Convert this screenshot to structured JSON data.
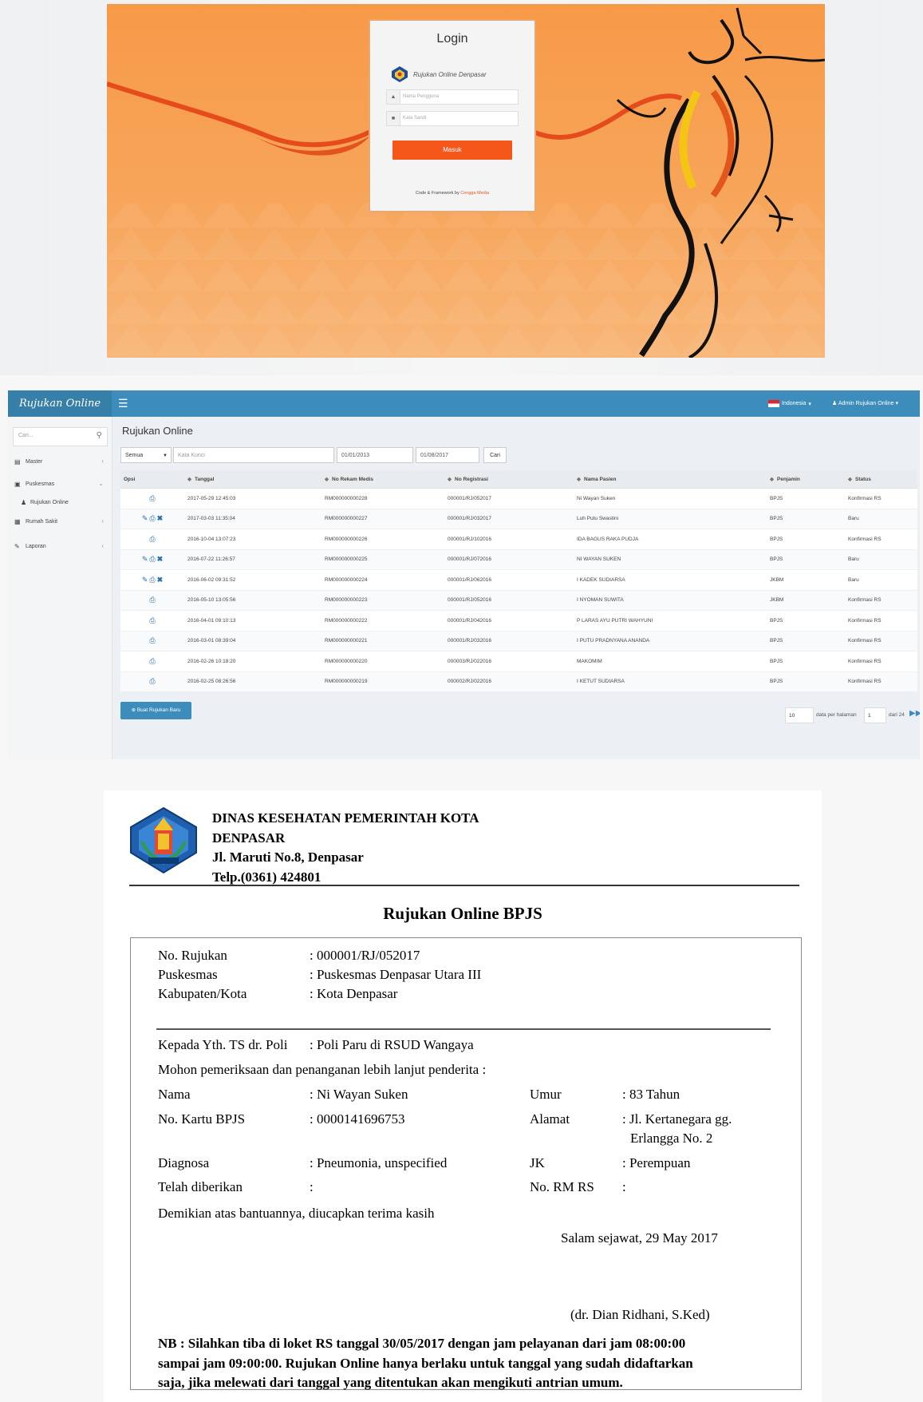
{
  "login": {
    "title": "Login",
    "app_name": "Rujukan Online Denpasar",
    "username_placeholder": "Nama Pengguna",
    "password_placeholder": "Kata Sandi",
    "submit_label": "Masuk",
    "footer_prefix": "Code & Framework by",
    "footer_link": "Cengga Media",
    "accent_color": "#f5561a"
  },
  "admin": {
    "brand": "Rujukan Online",
    "language": "Indonesia",
    "user": "Admin Rujukan Online",
    "search_placeholder": "Cari...",
    "menu": [
      {
        "label": "Master",
        "icon": "database-icon"
      },
      {
        "label": "Puskesmas",
        "icon": "plus-square-icon"
      },
      {
        "label": "Rujukan Online",
        "icon": "user-icon"
      },
      {
        "label": "Rumah Sakit",
        "icon": "hospital-icon"
      },
      {
        "label": "Laporan",
        "icon": "report-icon"
      }
    ],
    "page_title": "Rujukan Online",
    "filter": {
      "select_value": "Semua",
      "keyword_placeholder": "Kata Kunci",
      "date_from": "01/01/2013",
      "date_to": "01/08/2017",
      "search_button": "Cari"
    },
    "columns": [
      "Opsi",
      "Tanggal",
      "No Rekam Medis",
      "No Registrasi",
      "Nama Pasien",
      "Penjamin",
      "Status"
    ],
    "rows": [
      {
        "actions": "print",
        "tanggal": "2017-05-29 12:45:03",
        "rm": "RM000000000228",
        "reg": "000001/RJ/052017",
        "nama": "Ni Wayan Suken",
        "penjamin": "BPJS",
        "status": "Konfirmasi RS"
      },
      {
        "actions": "edit-print-delete",
        "tanggal": "2017-03-03 11:35:04",
        "rm": "RM000000000227",
        "reg": "000001/RJ/032017",
        "nama": "Luh Putu Swastini",
        "penjamin": "BPJS",
        "status": "Baru"
      },
      {
        "actions": "print",
        "tanggal": "2016-10-04 13:07:23",
        "rm": "RM000000000226",
        "reg": "000001/RJ/102016",
        "nama": "IDA BAGUS RAKA PUDJA",
        "penjamin": "BPJS",
        "status": "Konfirmasi RS"
      },
      {
        "actions": "edit-print-delete",
        "tanggal": "2016-07-22 11:26:57",
        "rm": "RM000000000225",
        "reg": "000001/RJ/072016",
        "nama": "NI WAYAN SUKEN",
        "penjamin": "BPJS",
        "status": "Baru"
      },
      {
        "actions": "edit-print-delete",
        "tanggal": "2016-06-02 09:31:52",
        "rm": "RM000000000224",
        "reg": "000001/RJ/062016",
        "nama": "I KADEK SUDIARSA",
        "penjamin": "JKBM",
        "status": "Baru"
      },
      {
        "actions": "print",
        "tanggal": "2016-05-10 13:05:56",
        "rm": "RM000000000223",
        "reg": "000001/RJ/052016",
        "nama": "I NYOMAN SUWITA",
        "penjamin": "JKBM",
        "status": "Konfirmasi RS"
      },
      {
        "actions": "print",
        "tanggal": "2016-04-01 09:10:13",
        "rm": "RM000000000222",
        "reg": "000001/RJ/042016",
        "nama": "P LARAS AYU PUTRI WAHYUNI",
        "penjamin": "BPJS",
        "status": "Konfirmasi RS"
      },
      {
        "actions": "print",
        "tanggal": "2016-03-01 08:39:04",
        "rm": "RM000000000221",
        "reg": "000001/RJ/032016",
        "nama": "I PUTU PRADNYANA ANANDA",
        "penjamin": "BPJS",
        "status": "Konfirmasi RS"
      },
      {
        "actions": "print",
        "tanggal": "2016-02-26 10:18:20",
        "rm": "RM000000000220",
        "reg": "000003/RJ/022016",
        "nama": "MAKOMIM",
        "penjamin": "BPJS",
        "status": "Konfirmasi RS"
      },
      {
        "actions": "print",
        "tanggal": "2016-02-25 08:26:56",
        "rm": "RM000000000219",
        "reg": "000002/RJ/022016",
        "nama": "I KETUT SUDIARSA",
        "penjamin": "BPJS",
        "status": "Konfirmasi RS"
      }
    ],
    "new_button": "Buat Rujukan Baru",
    "pager": {
      "per_page": "10",
      "per_page_label": "data per halaman",
      "page": "1",
      "total_label": "dari 24"
    },
    "theme_color": "#3c8dbc"
  },
  "letter": {
    "header_lines": [
      "DINAS KESEHATAN PEMERINTAH KOTA",
      "DENPASAR",
      "Jl. Maruti No.8, Denpasar",
      "Telp.(0361) 424801"
    ],
    "title": "Rujukan Online BPJS",
    "fields_top": [
      {
        "label": "No. Rujukan",
        "value": ": 000001/RJ/052017"
      },
      {
        "label": "Puskesmas",
        "value": ": Puskesmas Denpasar Utara III"
      },
      {
        "label": "Kabupaten/Kota",
        "value": ": Kota Denpasar"
      }
    ],
    "kepada_label": "Kepada Yth. TS dr. Poli",
    "kepada_value": ": Poli Paru di RSUD Wangaya",
    "mohon": "Mohon pemeriksaan dan penanganan lebih lanjut penderita :",
    "nama_label": "Nama",
    "nama_value": ": Ni Wayan Suken",
    "umur_label": "Umur",
    "umur_value": ": 83 Tahun",
    "kartu_label": "No. Kartu BPJS",
    "kartu_value": ": 0000141696753",
    "alamat_label": "Alamat",
    "alamat_value1": ": Jl. Kertanegara gg.",
    "alamat_value2": "Erlangga No. 2",
    "diagnosa_label": "Diagnosa",
    "diagnosa_value": ": Pneumonia, unspecified",
    "jk_label": "JK",
    "jk_value": ": Perempuan",
    "telah_label": "Telah diberikan",
    "telah_value": ":",
    "rm_label": "No. RM RS",
    "rm_value": ":",
    "demikian": "Demikian atas bantuannya, diucapkan terima kasih",
    "salam": "Salam sejawat, 29 May 2017",
    "signer": "(dr. Dian Ridhani, S.Ked)",
    "nb_lines": [
      "NB : Silahkan tiba di loket RS tanggal 30/05/2017 dengan jam pelayanan dari jam 08:00:00",
      "sampai jam 09:00:00. Rujukan Online hanya berlaku untuk tanggal yang sudah didaftarkan",
      "saja, jika melewati dari tanggal yang ditentukan akan mengikuti antrian umum."
    ]
  }
}
